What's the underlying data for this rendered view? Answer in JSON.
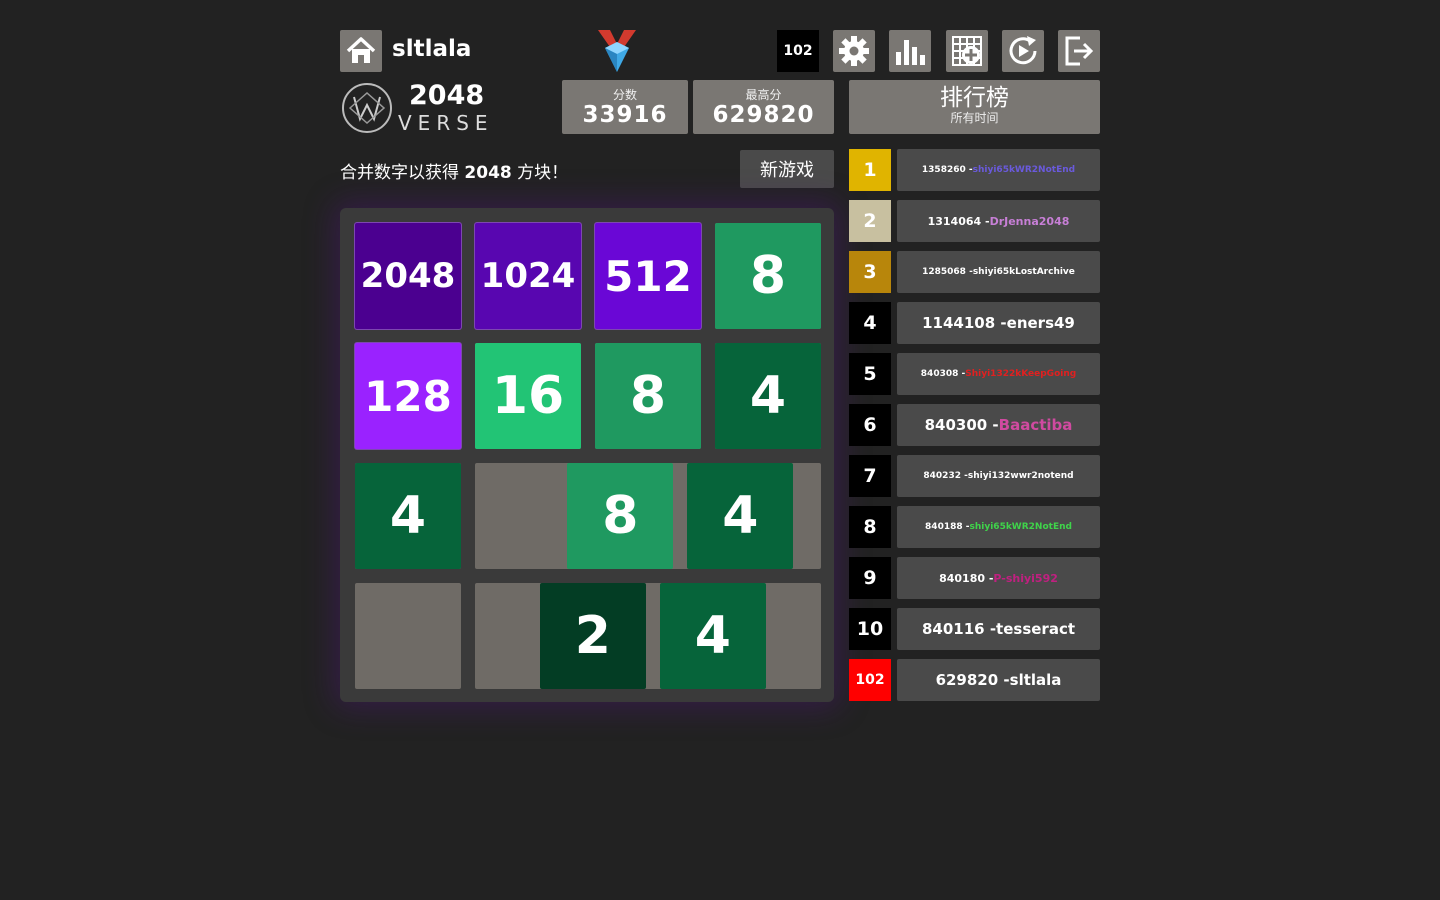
{
  "header": {
    "username": "sltlala",
    "rank_badge": "102",
    "icons": [
      "home-icon",
      "medal-icon",
      "settings-icon",
      "stats-icon",
      "add-grid-icon",
      "replay-icon",
      "logout-icon"
    ]
  },
  "logo": {
    "title": "2048",
    "subtitle": "VERSE"
  },
  "scores": {
    "score_label": "分数",
    "score_value": "33916",
    "best_label": "最高分",
    "best_value": "629820"
  },
  "leaderboard": {
    "title": "排行榜",
    "subtitle": "所有时间",
    "entries": [
      {
        "rank": "1",
        "score": "1358260 - ",
        "name": "shiyi65kWR2NotEnd",
        "rank_bg": "#e0b400",
        "name_color": "#6a5adc"
      },
      {
        "rank": "2",
        "score": "1314064 - ",
        "name": "DrJenna2048",
        "rank_bg": "#c8c0a0",
        "name_color": "#c77fd6"
      },
      {
        "rank": "3",
        "score": "1285068 - ",
        "name": "shiyi65kLostArchive",
        "rank_bg": "#b8860b",
        "name_color": "#ffffff"
      },
      {
        "rank": "4",
        "score": "1144108 - ",
        "name": "eners49",
        "rank_bg": "#000000",
        "name_color": "#ffffff"
      },
      {
        "rank": "5",
        "score": "840308 - ",
        "name": "Shiyi1322kKeepGoing",
        "rank_bg": "#000000",
        "name_color": "#e02020"
      },
      {
        "rank": "6",
        "score": "840300 - ",
        "name": "Baactiba",
        "rank_bg": "#000000",
        "name_color": "#d04aa0"
      },
      {
        "rank": "7",
        "score": "840232 - ",
        "name": "shiyi132wwr2notend",
        "rank_bg": "#000000",
        "name_color": "#ffffff"
      },
      {
        "rank": "8",
        "score": "840188 - ",
        "name": "shiyi65kWR2NotEnd",
        "rank_bg": "#000000",
        "name_color": "#3fd44a"
      },
      {
        "rank": "9",
        "score": "840180 - ",
        "name": "P-shiyi592",
        "rank_bg": "#000000",
        "name_color": "#c02080"
      },
      {
        "rank": "10",
        "score": "840116 - ",
        "name": "tesseract",
        "rank_bg": "#000000",
        "name_color": "#ffffff"
      },
      {
        "rank": "102",
        "score": "629820 - ",
        "name": "sltlala",
        "rank_bg": "#ff0000",
        "name_color": "#ffffff"
      }
    ]
  },
  "intro": {
    "prefix": "合并数字以获得 ",
    "bold": "2048",
    "suffix": " 方块！"
  },
  "new_game": "新游戏",
  "board": {
    "size": 4,
    "tiles": [
      {
        "row": 0,
        "col": 0,
        "value": "2048",
        "color": "#4b0090"
      },
      {
        "row": 0,
        "col": 1,
        "value": "1024",
        "color": "#5806b0"
      },
      {
        "row": 0,
        "col": 2,
        "value": "512",
        "color": "#6a07d6"
      },
      {
        "row": 0,
        "col": 3,
        "value": "8",
        "color": "#1f9960"
      },
      {
        "row": 1,
        "col": 0,
        "value": "128",
        "color": "#9a22ff"
      },
      {
        "row": 1,
        "col": 1,
        "value": "16",
        "color": "#22c475"
      },
      {
        "row": 1,
        "col": 2,
        "value": "8",
        "color": "#1f9960"
      },
      {
        "row": 1,
        "col": 3,
        "value": "4",
        "color": "#06643a"
      },
      {
        "row": 2,
        "col": 0,
        "value": "4",
        "color": "#06643a"
      },
      {
        "row": 2,
        "col": 1.77,
        "value": "8",
        "color": "#1f9960"
      },
      {
        "row": 2,
        "col": 2.77,
        "value": "4",
        "color": "#06643a"
      },
      {
        "row": 3,
        "col": 1.54,
        "value": "2",
        "color": "#033d24"
      },
      {
        "row": 3,
        "col": 2.54,
        "value": "4",
        "color": "#06643a"
      }
    ]
  }
}
